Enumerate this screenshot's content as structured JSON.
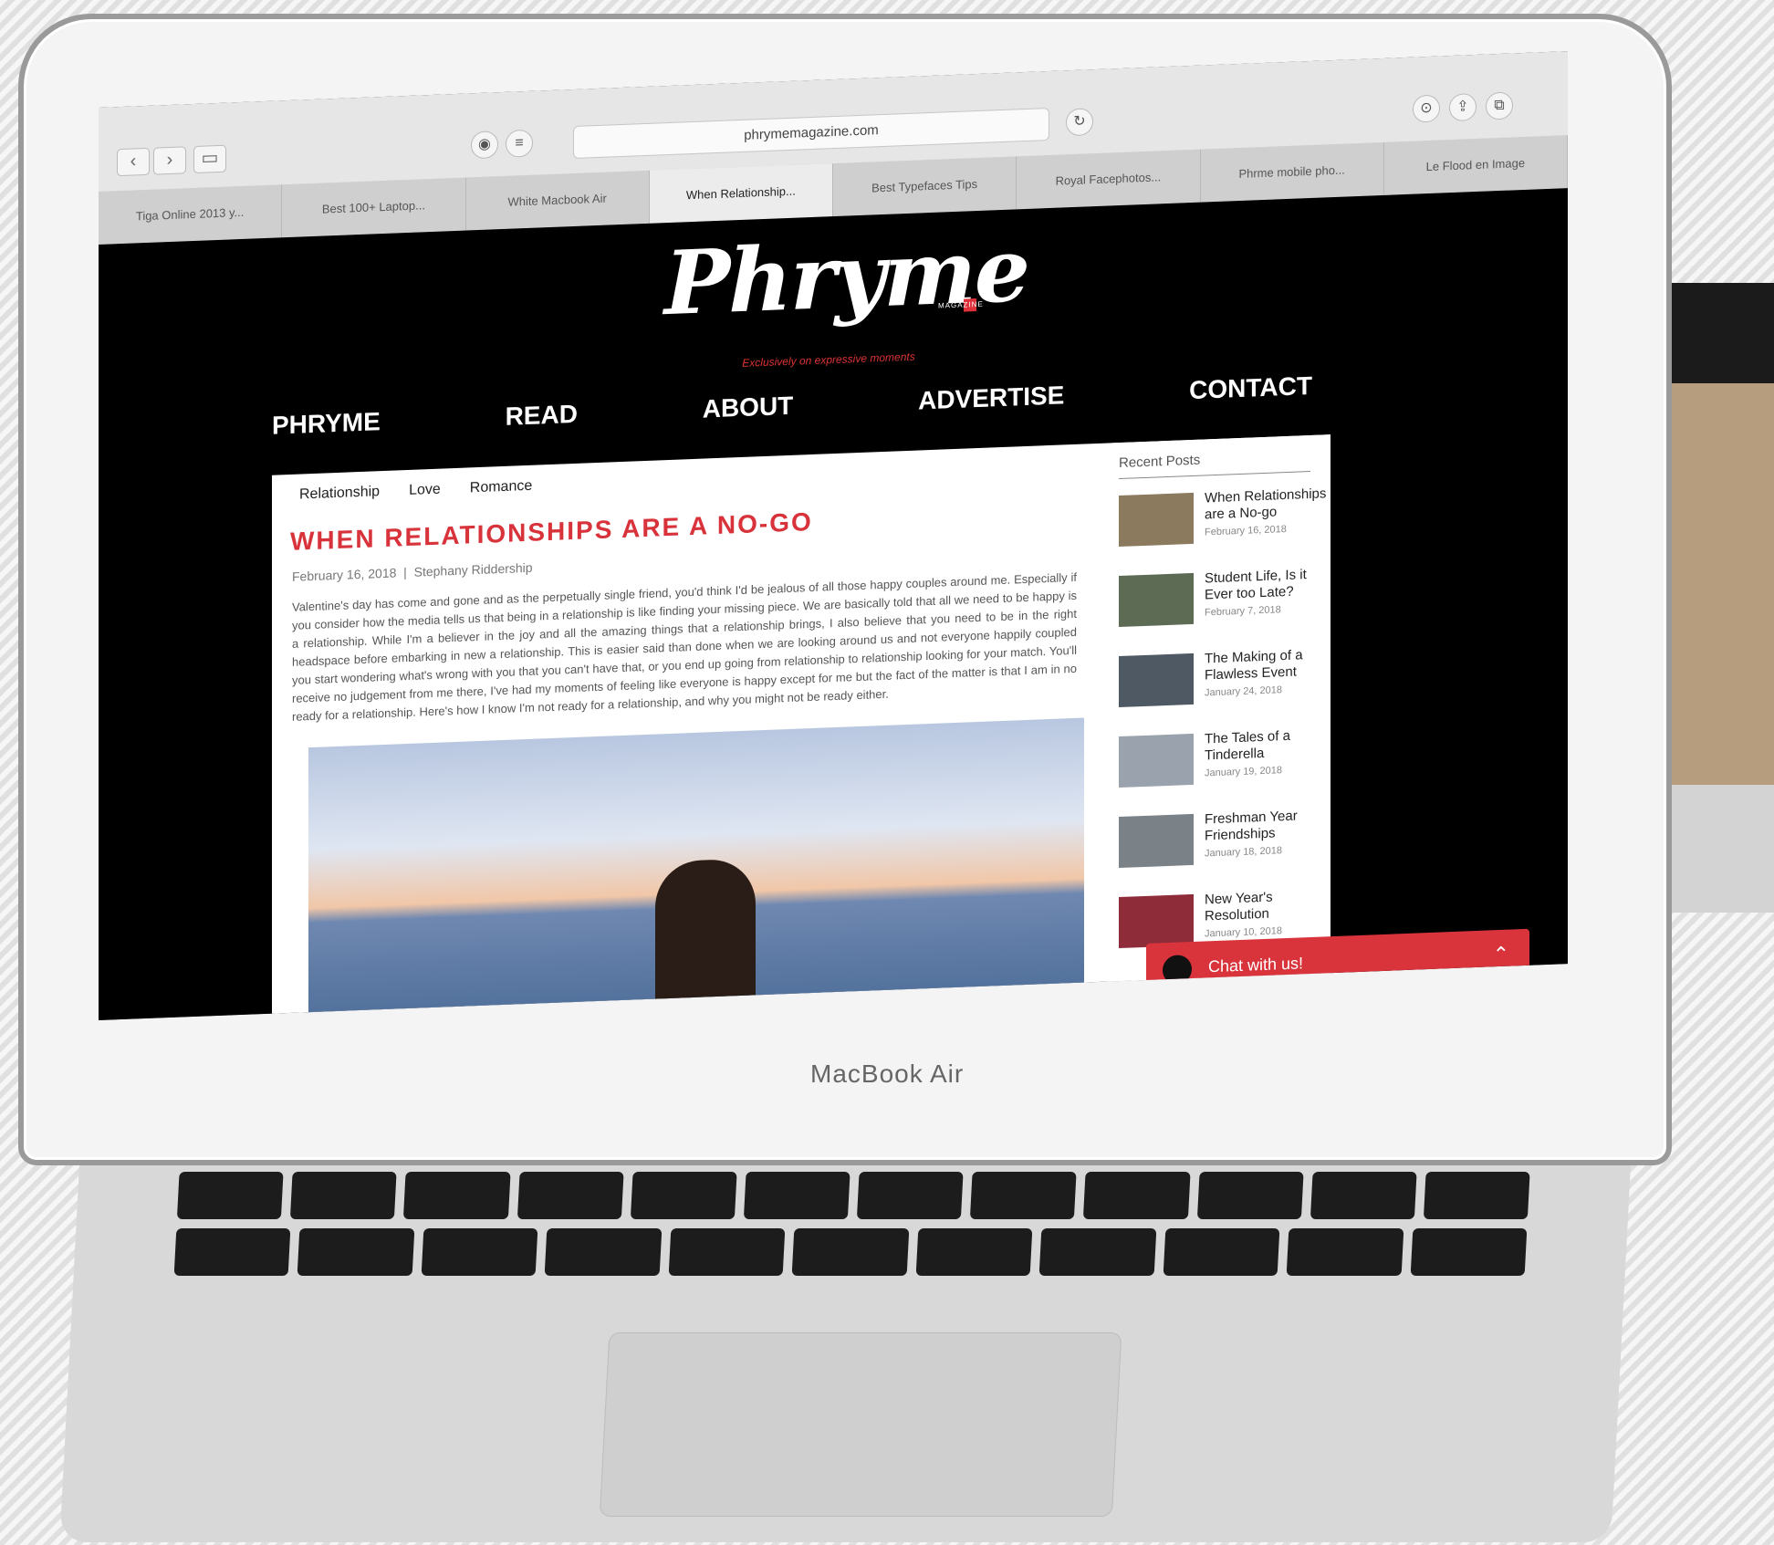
{
  "browser": {
    "url": "phrymemagazine.com",
    "tabs": [
      "Tiga Online 2013 y...",
      "Best 100+ Laptop...",
      "White Macbook Air",
      "When Relationship...",
      "Best Typefaces Tips",
      "Royal Facephotos...",
      "Phrme mobile pho...",
      "Le Flood en Image"
    ],
    "back_icon": "back-arrow-icon",
    "sidebar_icon": "sidebar-icon",
    "share_icon": "share-icon",
    "tabs_icon": "tabs-icon",
    "download_icon": "download-icon",
    "reload_icon": "reload-icon"
  },
  "site": {
    "logo": "Phryme",
    "logo_sub": "MAGAZINE",
    "tagline": "Exclusively on expressive moments",
    "nav": [
      "PHRYME",
      "READ",
      "ABOUT",
      "ADVERTISE",
      "CONTACT"
    ]
  },
  "post": {
    "categories": [
      "Relationship",
      "Love",
      "Romance"
    ],
    "title": "WHEN RELATIONSHIPS ARE A NO-GO",
    "date": "February 16, 2018",
    "author": "Stephany Riddership",
    "body": "Valentine's day has come and gone and as the perpetually single friend, you'd think I'd be jealous of all those happy couples around me. Especially if you consider how the media tells us that being in a relationship is like finding your missing piece. We are basically told that all we need to be happy is a relationship. While I'm a believer in the joy and all the amazing things that a relationship brings, I also believe that you need to be in the right headspace before embarking in new a relationship. This is easier said than done when we are looking around us and not everyone happily coupled you start wondering what's wrong with you that you can't have that, or you end up going from relationship to relationship looking for your match. You'll receive no judgement from me there, I've had my moments of feeling like everyone is happy except for me but the fact of the matter is that I am in no ready for a relationship. Here's how I know I'm not ready for a relationship, and why you might not be ready either."
  },
  "sidebar": {
    "title": "Recent Posts",
    "items": [
      {
        "title": "When Relationships are a No-go",
        "date": "February 16, 2018"
      },
      {
        "title": "Student Life, Is it Ever too Late?",
        "date": "February 7, 2018"
      },
      {
        "title": "The Making of a Flawless Event",
        "date": "January 24, 2018"
      },
      {
        "title": "The Tales of a Tinderella",
        "date": "January 19, 2018"
      },
      {
        "title": "Freshman Year Friendships",
        "date": "January 18, 2018"
      },
      {
        "title": "New Year's Resolution",
        "date": "January 10, 2018"
      }
    ]
  },
  "chat": {
    "label": "Chat with us!",
    "toggle_icon": "chevron-up-icon"
  },
  "device": {
    "brand": "MacBook Air"
  }
}
